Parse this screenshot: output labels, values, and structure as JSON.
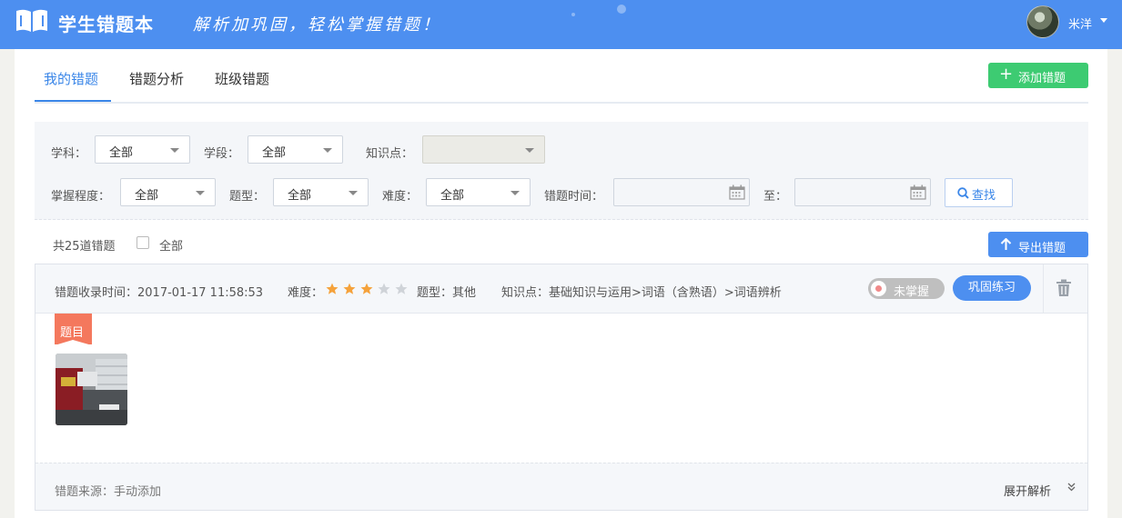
{
  "header": {
    "title": "学生错题本",
    "slogan": "解析加巩固，轻松掌握错题！",
    "username": "米洋",
    "logo_icon": "open-book-icon",
    "bg_color": "#4d8ff0"
  },
  "tabs": [
    {
      "label": "我的错题",
      "active": true
    },
    {
      "label": "错题分析",
      "active": false
    },
    {
      "label": "班级错题",
      "active": false
    }
  ],
  "add_button": {
    "label": "添加错题",
    "icon": "plus-icon",
    "color": "#3dcb72"
  },
  "filters": {
    "subject": {
      "label": "学科：",
      "value": "全部"
    },
    "stage": {
      "label": "学段：",
      "value": "全部"
    },
    "knowledge": {
      "label": "知识点：",
      "value": ""
    },
    "mastery": {
      "label": "掌握程度：",
      "value": "全部"
    },
    "qtype": {
      "label": "题型：",
      "value": "全部"
    },
    "difficulty": {
      "label": "难度：",
      "value": "全部"
    },
    "time": {
      "label": "错题时间：",
      "start": "",
      "to": "至：",
      "end": ""
    },
    "search_label": "查找"
  },
  "list": {
    "count_text": "共25道错题",
    "select_all": "全部",
    "export_label": "导出错题"
  },
  "question": {
    "recorded_time": "错题收录时间：2017-01-17 11:58:53",
    "difficulty_label": "难度：",
    "difficulty_rating": 3,
    "difficulty_max": 5,
    "type": "题型：其他",
    "knowledge": "知识点：基础知识与运用>词语（含熟语）>词语辨析",
    "mastery_status": "未掌握",
    "practice_label": "巩固练习",
    "tag": "题目",
    "source": "错题来源：手动添加",
    "expand_label": "展开解析",
    "star_color": "#f5a23b"
  }
}
